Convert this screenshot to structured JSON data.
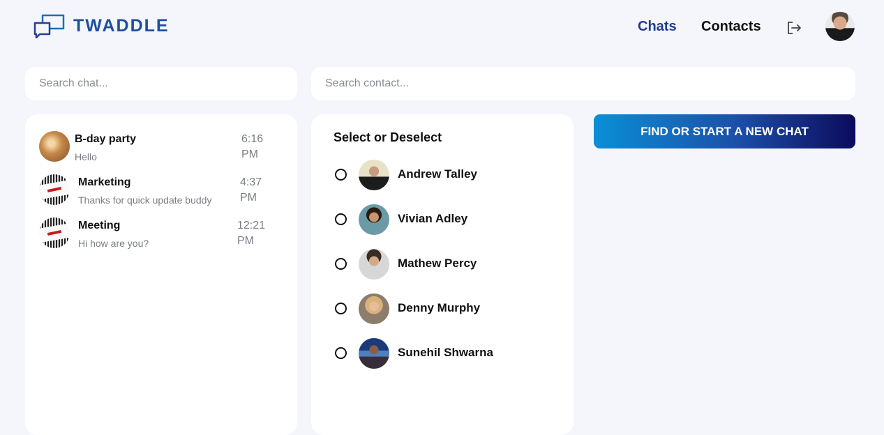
{
  "brand": {
    "name": "TWADDLE",
    "color": "#1e4f9c"
  },
  "nav": {
    "chats": "Chats",
    "contacts": "Contacts",
    "active": "Chats",
    "active_color": "#213b8f"
  },
  "icons": {
    "logo": "chat-bubbles-icon",
    "logout": "logout-icon"
  },
  "search": {
    "chat_placeholder": "Search chat...",
    "contact_placeholder": "Search contact..."
  },
  "chats": [
    {
      "name": "B-day party",
      "message": "Hello",
      "time_line1": "6:16",
      "time_line2": "PM"
    },
    {
      "name": "Marketing",
      "message": "Thanks for quick update buddy",
      "time_line1": "4:37",
      "time_line2": "PM"
    },
    {
      "name": "Meeting",
      "message": "Hi how are you?",
      "time_line1": "12:21",
      "time_line2": "PM"
    }
  ],
  "contacts": {
    "title": "Select or Deselect",
    "items": [
      {
        "name": "Andrew Talley"
      },
      {
        "name": "Vivian Adley"
      },
      {
        "name": "Mathew Percy"
      },
      {
        "name": "Denny Murphy"
      },
      {
        "name": "Sunehil Shwarna"
      }
    ]
  },
  "cta": {
    "label": "FIND OR START A NEW CHAT",
    "gradient": [
      "#0a8fd6",
      "#0c0a5c"
    ]
  }
}
